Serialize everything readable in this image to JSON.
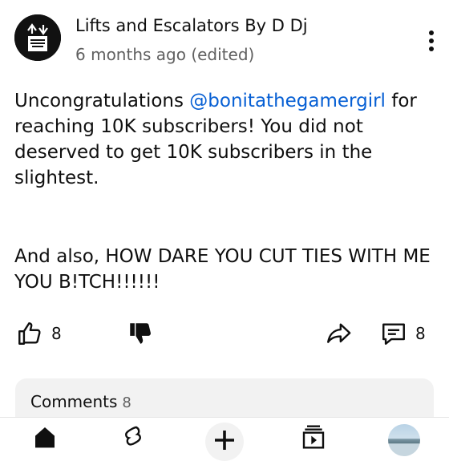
{
  "post": {
    "channel_name": "Lifts and Escalators By D Dj",
    "timestamp": "6 months ago (edited)",
    "text_before_mention": "Uncongratulations ",
    "mention": "@bonitathegamergirl",
    "text_after_mention": " for reaching 10K subscribers! You did not deserved to get 10K subscribers in the slightest.",
    "second_paragraph": "And also, HOW DARE YOU CUT TIES WITH ME YOU B!TCH!!!!!!"
  },
  "actions": {
    "like_count": "8",
    "comment_count": "8"
  },
  "comments": {
    "label": "Comments",
    "count": "8"
  },
  "nav": {
    "items": [
      "home-icon",
      "shorts-icon",
      "create-icon",
      "subscriptions-icon",
      "profile-avatar"
    ]
  },
  "colors": {
    "mention": "#065fd4",
    "secondary_text": "#606060",
    "comments_bg": "#f2f2f2"
  }
}
